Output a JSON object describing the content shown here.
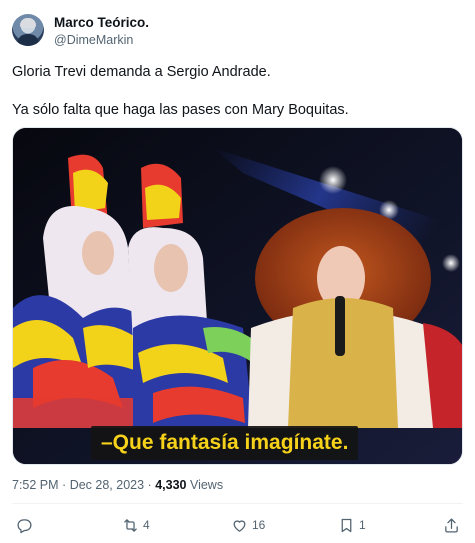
{
  "author": {
    "display_name": "Marco Teórico.",
    "handle": "@DimeMarkin"
  },
  "tweet": {
    "line1": "Gloria Trevi demanda a Sergio Andrade.",
    "line2": "Ya sólo falta que haga las pases con Mary Boquitas."
  },
  "media": {
    "subtitle": "–Que fantasía imagínate.",
    "subtitle_color": "#f7d21a"
  },
  "meta": {
    "time": "7:52 PM",
    "separator": "·",
    "date": "Dec 28, 2023",
    "views_count": "4,330",
    "views_label": "Views"
  },
  "actions": {
    "reply_count": "",
    "retweet_count": "4",
    "like_count": "16",
    "bookmark_count": "1"
  },
  "colors": {
    "text_primary": "#0f1419",
    "text_secondary": "#536471",
    "divider": "#eff3f4"
  }
}
